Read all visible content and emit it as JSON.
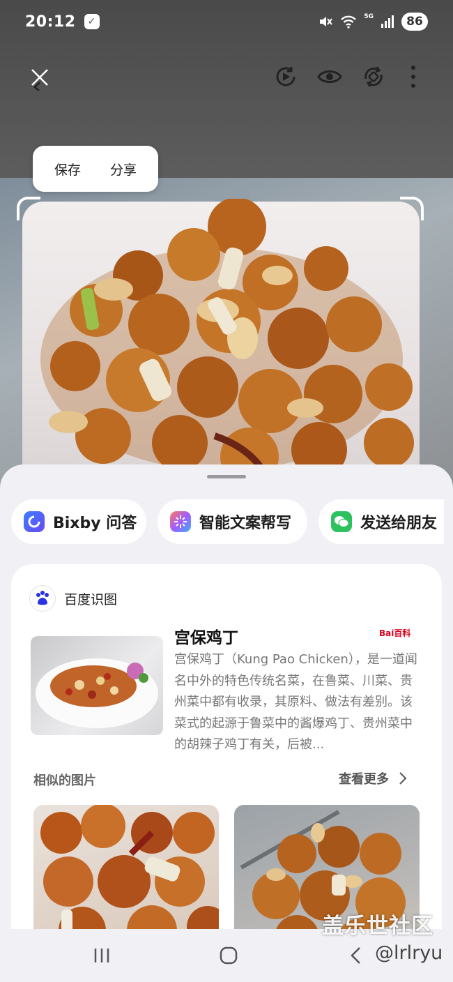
{
  "status_bar": {
    "time": "20:12",
    "network": "5G",
    "battery": "86"
  },
  "toolbar": {
    "icons": [
      "close-icon",
      "motion-photo-icon",
      "eye-icon",
      "rotate-icon",
      "more-icon"
    ]
  },
  "popup": {
    "save_label": "保存",
    "share_label": "分享"
  },
  "actions": [
    {
      "label": "Bixby 问答",
      "icon": "bixby-icon"
    },
    {
      "label": "智能文案帮写",
      "icon": "smart-writing-icon"
    },
    {
      "label": "发送给朋友",
      "icon": "wechat-icon"
    }
  ],
  "baidu_card": {
    "source": "百度识图",
    "title": "宫保鸡丁",
    "badge": "Bai百科",
    "description": "宫保鸡丁（Kung Pao Chicken），是一道闻名中外的特色传统名菜，在鲁菜、川菜、贵州菜中都有收录，其原料、做法有差别。该菜式的起源于鲁菜中的酱爆鸡丁、贵州菜中的胡辣子鸡丁有关，后被...",
    "similar_label": "相似的图片",
    "see_more_label": "查看更多"
  },
  "watermark": {
    "site": "盖乐世社区",
    "user": "@lrlryu"
  },
  "colors": {
    "sheet_bg": "#f1f1f5",
    "baidu_red": "#d9001b",
    "wechat_green": "#2dc160",
    "bixby_blue": "#3b7bff"
  }
}
